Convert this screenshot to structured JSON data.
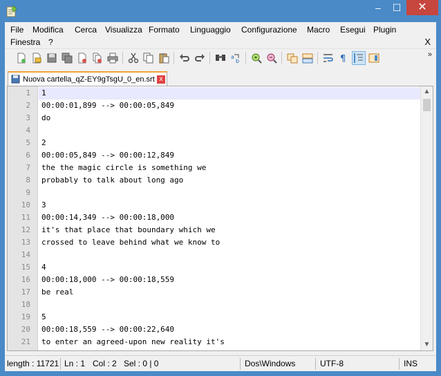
{
  "window": {
    "controls": {
      "minimize": "–",
      "maximize": "☐",
      "close": "✕"
    }
  },
  "menu": {
    "items": [
      "File",
      "Modifica",
      "Cerca",
      "Visualizza",
      "Formato",
      "Linguaggio",
      "Configurazione",
      "Macro",
      "Esegui",
      "Plugin"
    ],
    "items_row2": [
      "Finestra",
      "?"
    ],
    "close_document": "X"
  },
  "toolbar": {
    "buttons": [
      "new-file-icon",
      "open-file-icon",
      "save-icon",
      "save-all-icon",
      "close-icon",
      "close-all-icon",
      "print-icon",
      "cut-icon",
      "copy-icon",
      "paste-icon",
      "undo-icon",
      "redo-icon",
      "find-icon",
      "replace-icon",
      "zoom-in-icon",
      "zoom-out-icon",
      "sync-vertical-icon",
      "sync-horizontal-icon",
      "word-wrap-icon",
      "show-all-characters-icon",
      "indent-guide-icon",
      "document-map-icon"
    ],
    "overflow": "»"
  },
  "tab": {
    "label": "Nuova cartella_qZ-EY9gTsgU_0_en.srt",
    "close": "x"
  },
  "editor": {
    "current_line": 1,
    "lines": [
      {
        "n": "1",
        "text": "1"
      },
      {
        "n": "2",
        "text": "00:00:01,899 --> 00:00:05,849"
      },
      {
        "n": "3",
        "text": "do"
      },
      {
        "n": "4",
        "text": ""
      },
      {
        "n": "5",
        "text": "2"
      },
      {
        "n": "6",
        "text": "00:00:05,849 --> 00:00:12,849"
      },
      {
        "n": "7",
        "text": "the the magic circle is something we"
      },
      {
        "n": "8",
        "text": "probably to talk about long ago"
      },
      {
        "n": "9",
        "text": ""
      },
      {
        "n": "10",
        "text": "3"
      },
      {
        "n": "11",
        "text": "00:00:14,349 --> 00:00:18,000"
      },
      {
        "n": "12",
        "text": "it's that place that boundary which we"
      },
      {
        "n": "13",
        "text": "crossed to leave behind what we know to"
      },
      {
        "n": "14",
        "text": ""
      },
      {
        "n": "15",
        "text": "4"
      },
      {
        "n": "16",
        "text": "00:00:18,000 --> 00:00:18,559"
      },
      {
        "n": "17",
        "text": "be real"
      },
      {
        "n": "18",
        "text": ""
      },
      {
        "n": "19",
        "text": "5"
      },
      {
        "n": "20",
        "text": "00:00:18,559 --> 00:00:22,640"
      },
      {
        "n": "21",
        "text": "to enter an agreed-upon new reality it's"
      }
    ]
  },
  "scrollbar": {
    "up": "▲",
    "down": "▼"
  },
  "status": {
    "length": "length : 11721",
    "line": "Ln : 1",
    "col": "Col : 2",
    "sel": "Sel : 0 | 0",
    "eol": "Dos\\Windows",
    "encoding": "UTF-8",
    "mode": "INS"
  },
  "colors": {
    "titlebar": "#4a8ac7",
    "close_button": "#c7463d",
    "current_line": "#e8e8ff",
    "tab_accent": "#f4a236"
  }
}
